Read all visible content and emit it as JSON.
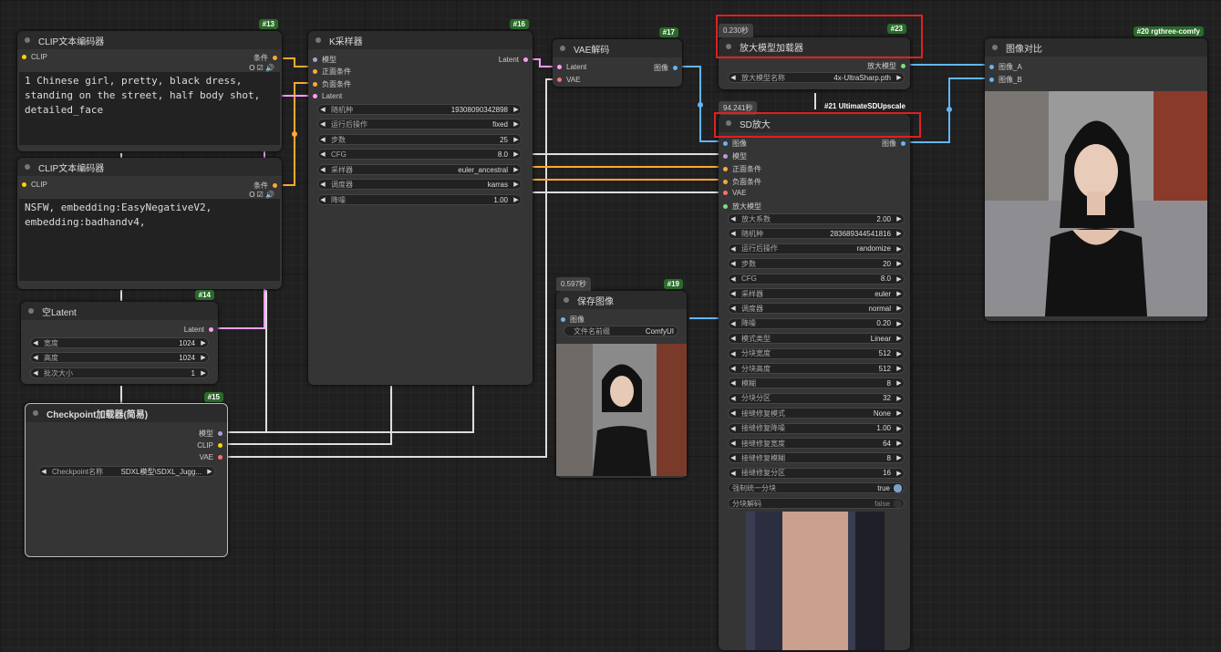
{
  "nodes": {
    "clip1": {
      "id": "#13",
      "title": "CLIP文本编码器",
      "input": "CLIP",
      "output": "条件",
      "text": "1 Chinese girl, pretty, black dress,\nstanding on the street, half body shot,\ndetailed_face"
    },
    "clip2": {
      "title": "CLIP文本编码器",
      "input": "CLIP",
      "output": "条件",
      "text": "NSFW, embedding:EasyNegativeV2,\nembedding:badhandv4,"
    },
    "latent": {
      "id": "#14",
      "title": "空Latent",
      "output": "Latent",
      "w": [
        {
          "l": "宽度",
          "v": "1024"
        },
        {
          "l": "高度",
          "v": "1024"
        },
        {
          "l": "批次大小",
          "v": "1"
        }
      ]
    },
    "ckpt": {
      "id": "#15",
      "title": "Checkpoint加载器(简易)",
      "outputs": [
        "模型",
        "CLIP",
        "VAE"
      ],
      "w": [
        {
          "l": "Checkpoint名称",
          "v": "SDXL模型\\SDXL_Jugg..."
        }
      ]
    },
    "ksampler": {
      "id": "#16",
      "title": "K采样器",
      "inputs": [
        "模型",
        "正面条件",
        "负面条件",
        "Latent"
      ],
      "output": "Latent",
      "w": [
        {
          "l": "随机种",
          "v": "19308090342898"
        },
        {
          "l": "运行后操作",
          "v": "fixed"
        },
        {
          "l": "步数",
          "v": "25"
        },
        {
          "l": "CFG",
          "v": "8.0"
        },
        {
          "l": "采样器",
          "v": "euler_ancestral"
        },
        {
          "l": "调度器",
          "v": "karras"
        },
        {
          "l": "降噪",
          "v": "1.00"
        }
      ]
    },
    "vae": {
      "id": "#17",
      "title": "VAE解码",
      "inputs": [
        "Latent",
        "VAE"
      ],
      "output": "图像"
    },
    "upmodel": {
      "id": "#23",
      "time": "0.230秒",
      "title": "放大模型加载器",
      "output": "放大模型",
      "w": [
        {
          "l": "放大模型名称",
          "v": "4x-UltraSharp.pth"
        }
      ]
    },
    "sd": {
      "id": "#21 UltimateSDUpscale",
      "time": "94.241秒",
      "title": "SD放大",
      "inputs": [
        "图像",
        "模型",
        "正面条件",
        "负面条件",
        "VAE",
        "放大模型"
      ],
      "output": "图像",
      "w": [
        {
          "l": "放大系数",
          "v": "2.00"
        },
        {
          "l": "随机种",
          "v": "283689344541816"
        },
        {
          "l": "运行后操作",
          "v": "randomize"
        },
        {
          "l": "步数",
          "v": "20"
        },
        {
          "l": "CFG",
          "v": "8.0"
        },
        {
          "l": "采样器",
          "v": "euler"
        },
        {
          "l": "调度器",
          "v": "normal"
        },
        {
          "l": "降噪",
          "v": "0.20"
        },
        {
          "l": "模式类型",
          "v": "Linear"
        },
        {
          "l": "分块宽度",
          "v": "512"
        },
        {
          "l": "分块高度",
          "v": "512"
        },
        {
          "l": "模糊",
          "v": "8"
        },
        {
          "l": "分块分区",
          "v": "32"
        },
        {
          "l": "接缝修复模式",
          "v": "None"
        },
        {
          "l": "接缝修复降噪",
          "v": "1.00"
        },
        {
          "l": "接缝修复宽度",
          "v": "64"
        },
        {
          "l": "接缝修复模糊",
          "v": "8"
        },
        {
          "l": "接缝修复分区",
          "v": "16"
        }
      ],
      "t1": {
        "l": "强制统一分块",
        "v": "true"
      },
      "t2": {
        "l": "分块解码",
        "v": "false"
      }
    },
    "save": {
      "id": "#19",
      "time": "0.597秒",
      "title": "保存图像",
      "input": "图像",
      "w": [
        {
          "l": "文件名前缀",
          "v": "ComfyUI"
        }
      ]
    },
    "compare": {
      "id": "#20 rgthree-comfy",
      "title": "图像对比",
      "inputs": [
        "图像_A",
        "图像_B"
      ]
    }
  },
  "colors": {
    "clip": "#ffd500",
    "cond": "#ffa931",
    "latent": "#ff9cf9",
    "model": "#b39ddb",
    "vae": "#ff6e6e",
    "image": "#64b5f6",
    "upscale": "#7be07b"
  }
}
